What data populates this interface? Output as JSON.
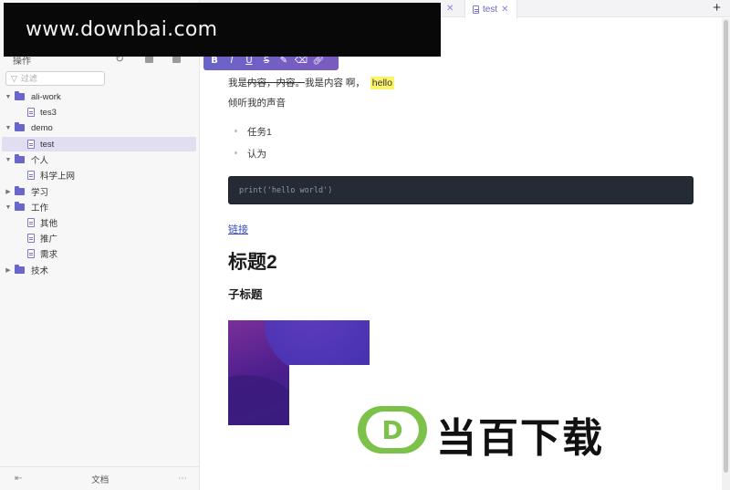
{
  "sidebar": {
    "section_label": "操作",
    "filter_placeholder": "过滤",
    "tree": [
      {
        "label": "ali-work",
        "kind": "folder",
        "expanded": true
      },
      {
        "label": "tes3",
        "kind": "doc"
      },
      {
        "label": "demo",
        "kind": "folder",
        "expanded": true
      },
      {
        "label": "test",
        "kind": "doc",
        "selected": true
      },
      {
        "label": "个人",
        "kind": "folder",
        "expanded": true
      },
      {
        "label": "科学上网",
        "kind": "doc"
      },
      {
        "label": "学习",
        "kind": "folder",
        "expanded": false
      },
      {
        "label": "工作",
        "kind": "folder",
        "expanded": true
      },
      {
        "label": "其他",
        "kind": "doc"
      },
      {
        "label": "推广",
        "kind": "doc"
      },
      {
        "label": "需求",
        "kind": "doc"
      },
      {
        "label": "技术",
        "kind": "folder",
        "expanded": false
      }
    ],
    "footer_label": "文档"
  },
  "tabs": {
    "active": "test",
    "new_tab": "+"
  },
  "toolbar": {
    "buttons": [
      "B",
      "I",
      "U",
      "S",
      "highlight",
      "clear-format",
      "link"
    ]
  },
  "document": {
    "line1_prefix": "我是",
    "line1_struck": "内容，内容。",
    "line1_middle": "我是内容 啊，",
    "line1_highlight": "hello",
    "line2": "倾听我的声音",
    "list_items": [
      "任务1",
      "认为"
    ],
    "code": "print('hello world')",
    "link_text": "链接",
    "heading2": "标题2",
    "heading3": "子标题"
  },
  "watermarks": {
    "top_url": "www.downbai.com",
    "bottom_logo_letter": "D",
    "bottom_text": "当百下载"
  },
  "colors": {
    "accent": "#6b66c9",
    "selected_row": "#e2def2",
    "highlight": "#fbf36b",
    "code_bg": "#242b35",
    "link": "#3c4fb6"
  }
}
